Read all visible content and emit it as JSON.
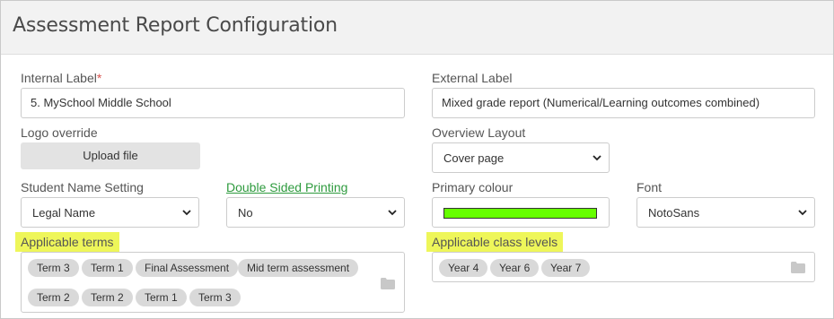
{
  "page": {
    "title": "Assessment Report Configuration"
  },
  "fields": {
    "internal_label": {
      "label": "Internal Label",
      "required_mark": "*",
      "value": "5. MySchool Middle School"
    },
    "external_label": {
      "label": "External Label",
      "value": "Mixed grade report (Numerical/Learning outcomes combined)"
    },
    "logo_override": {
      "label": "Logo override",
      "button": "Upload file"
    },
    "overview_layout": {
      "label": "Overview Layout",
      "selected": "Cover page"
    },
    "student_name_setting": {
      "label": "Student Name Setting",
      "selected": "Legal Name"
    },
    "double_sided_printing": {
      "label": "Double Sided Printing",
      "selected": "No"
    },
    "primary_colour": {
      "label": "Primary colour",
      "value_color": "#66ff00"
    },
    "font": {
      "label": "Font",
      "selected": "NotoSans"
    },
    "applicable_terms": {
      "label": "Applicable terms",
      "tags": [
        "Term 3",
        "Term 1",
        "Final Assessment",
        "Mid term assessment",
        "Term 2",
        "Term 2",
        "Term 1",
        "Term 3"
      ]
    },
    "applicable_class_levels": {
      "label": "Applicable class levels",
      "tags": [
        "Year 4",
        "Year 6",
        "Year 7"
      ]
    }
  },
  "icons": {
    "select_arrow": "chevron-down-icon",
    "tag_picker": "folder-icon"
  },
  "colors": {
    "highlight": "#eef65a",
    "link": "#2e9b3e",
    "required": "#d9534f"
  }
}
